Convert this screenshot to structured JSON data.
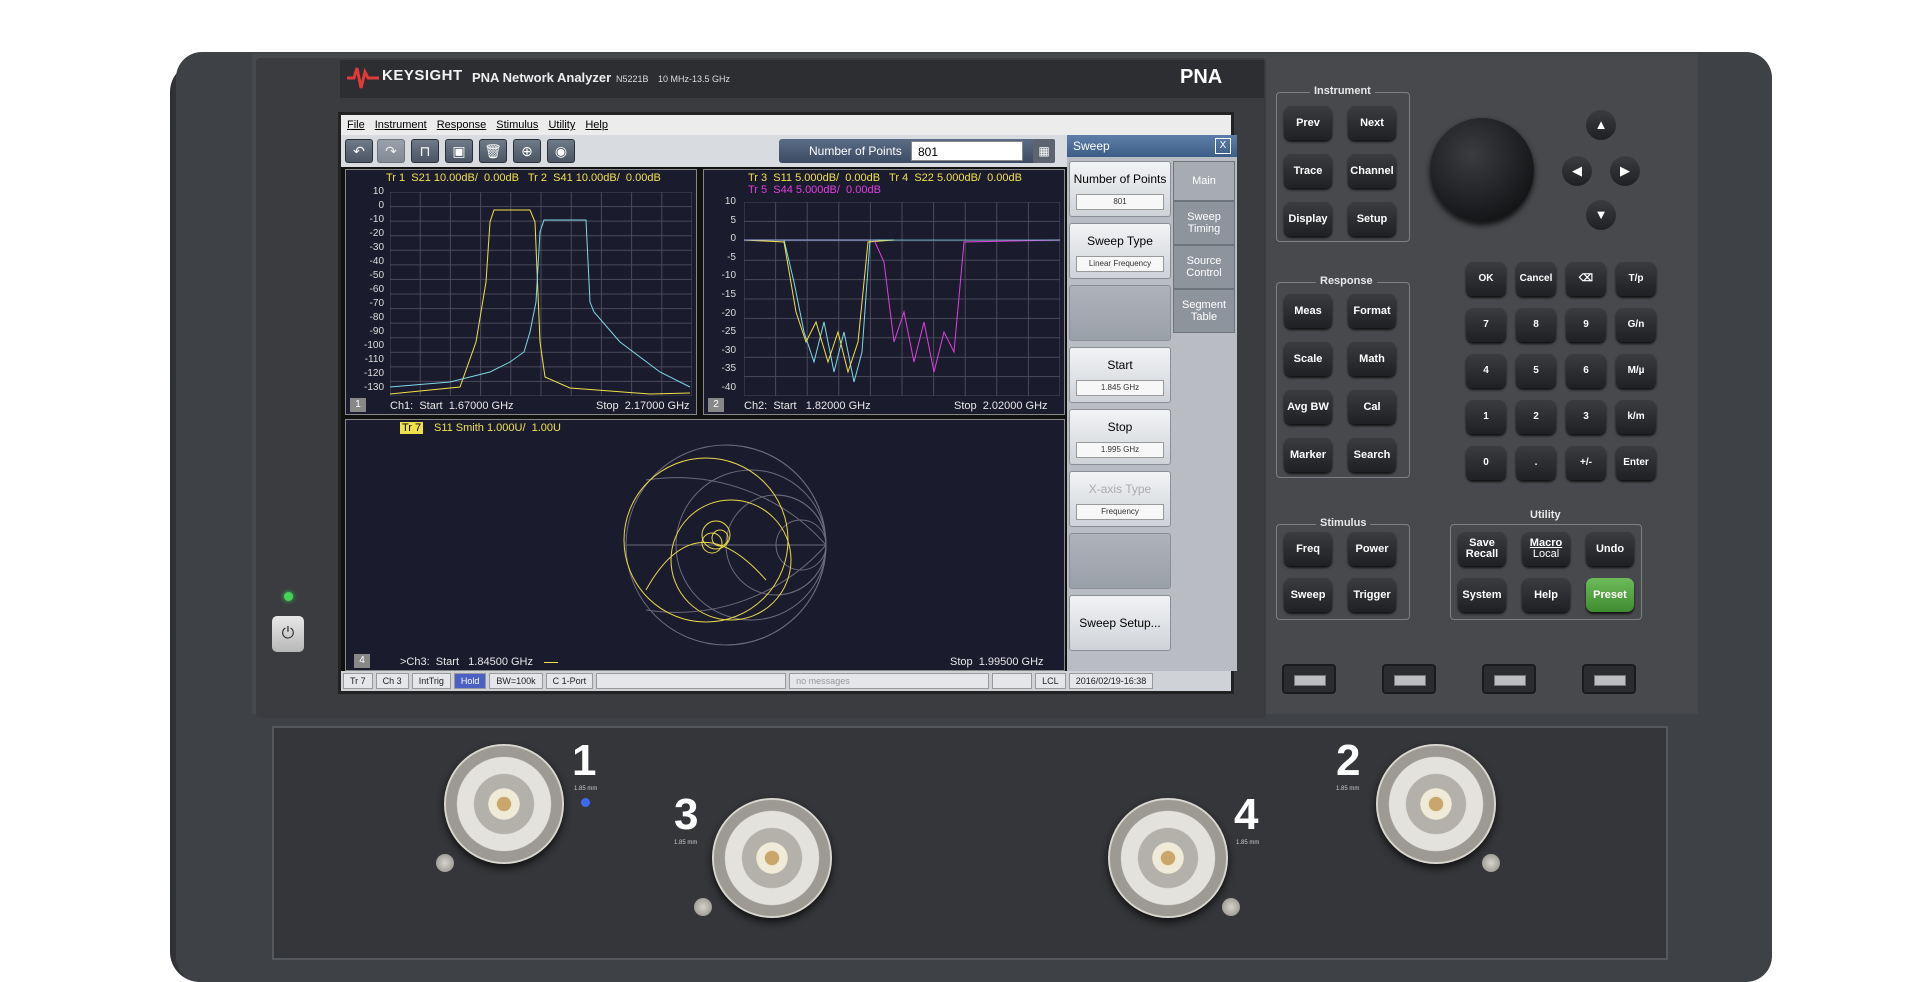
{
  "brand": {
    "logo": "KEYSIGHT",
    "model": "PNA Network Analyzer",
    "model_no": "N5221B",
    "range": "10 MHz-13.5 GHz",
    "family": "PNA"
  },
  "menu": [
    "File",
    "Instrument",
    "Response",
    "Stimulus",
    "Utility",
    "Help"
  ],
  "toolbar": {
    "icons": [
      "undo-icon",
      "redo-icon",
      "marker-icon",
      "screenshot-icon",
      "delete-icon",
      "zoom-icon",
      "camera-icon"
    ],
    "nop_label": "Number of Points",
    "nop_value": "801",
    "keypad_icon": "▦"
  },
  "win1": {
    "trace_header": "Tr 1  S21 10.00dB/  0.00dB   Tr 2  S41 10.00dB/  0.00dB",
    "footer_left": "Ch1:  Start  1.67000 GHz",
    "footer_right": "Stop  2.17000 GHz",
    "num": "1",
    "yticks": [
      "10",
      "0",
      "-10",
      "-20",
      "-30",
      "-40",
      "-50",
      "-60",
      "-70",
      "-80",
      "-90",
      "-100",
      "-110",
      "-120",
      "-130"
    ]
  },
  "win2": {
    "trace_header1": "Tr 3  S11 5.000dB/  0.00dB   Tr 4  S22 5.000dB/  0.00dB",
    "trace_header2": "Tr 5  S44 5.000dB/  0.00dB",
    "footer_left": "Ch2:  Start   1.82000 GHz",
    "footer_right": "Stop  2.02000 GHz",
    "num": "2",
    "yticks": [
      "10",
      "5",
      "0",
      "-5",
      "-10",
      "-15",
      "-20",
      "-25",
      "-30",
      "-35",
      "-40"
    ]
  },
  "win3": {
    "trace_tag": "Tr 7",
    "trace_header": "S11 Smith 1.000U/  1.00U",
    "footer_left": ">Ch3:  Start   1.84500 GHz",
    "footer_right": "Stop  1.99500 GHz",
    "num": "4"
  },
  "side": {
    "title": "Sweep",
    "close": "X",
    "buttons": [
      {
        "label": "Number of Points",
        "value": "801"
      },
      {
        "label": "Sweep Type",
        "value": "Linear Frequency"
      },
      {
        "label": "",
        "value": ""
      },
      {
        "label": "Start",
        "value": "1.845 GHz"
      },
      {
        "label": "Stop",
        "value": "1.995 GHz"
      },
      {
        "label": "X-axis Type",
        "value": "Frequency"
      },
      {
        "label": "",
        "value": ""
      },
      {
        "label": "Sweep Setup...",
        "value": ""
      }
    ],
    "tabs": [
      "Main",
      "Sweep Timing",
      "Source Control",
      "Segment Table"
    ]
  },
  "status": [
    "Tr 7",
    "Ch 3",
    "IntTrig",
    "Hold",
    "BW=100k",
    "C  1-Port",
    "",
    "no messages",
    "",
    "LCL",
    "2016/02/19-16:38"
  ],
  "groups": {
    "instrument": "Instrument",
    "response": "Response",
    "stimulus": "Stimulus",
    "utility": "Utility"
  },
  "keys": {
    "instrument": [
      "Prev",
      "Next",
      "Trace",
      "Channel",
      "Display",
      "Setup"
    ],
    "response": [
      "Meas",
      "Format",
      "Scale",
      "Math",
      "Avg BW",
      "Cal",
      "Marker",
      "Search"
    ],
    "stimulus": [
      "Freq",
      "Power",
      "Sweep",
      "Trigger"
    ],
    "utility_save": [
      "Save",
      "Recall"
    ],
    "utility_macro": [
      "Macro",
      "Local"
    ],
    "utility": [
      "Undo",
      "System",
      "Help",
      "Preset"
    ],
    "keypad": [
      "OK",
      "Cancel",
      "⌫",
      "T/p",
      "7",
      "8",
      "9",
      "G/n",
      "4",
      "5",
      "6",
      "M/µ",
      "1",
      "2",
      "3",
      "k/m",
      "0",
      ".",
      "+/-",
      "Enter"
    ],
    "arrows": [
      "▲",
      "◀",
      "▶",
      "▼"
    ]
  },
  "ports": [
    {
      "num": "1",
      "conn": "1.85 mm"
    },
    {
      "num": "2",
      "conn": "1.85 mm"
    },
    {
      "num": "3",
      "conn": "1.85 mm"
    },
    {
      "num": "4",
      "conn": "1.85 mm"
    }
  ],
  "power_icon": "⏻"
}
